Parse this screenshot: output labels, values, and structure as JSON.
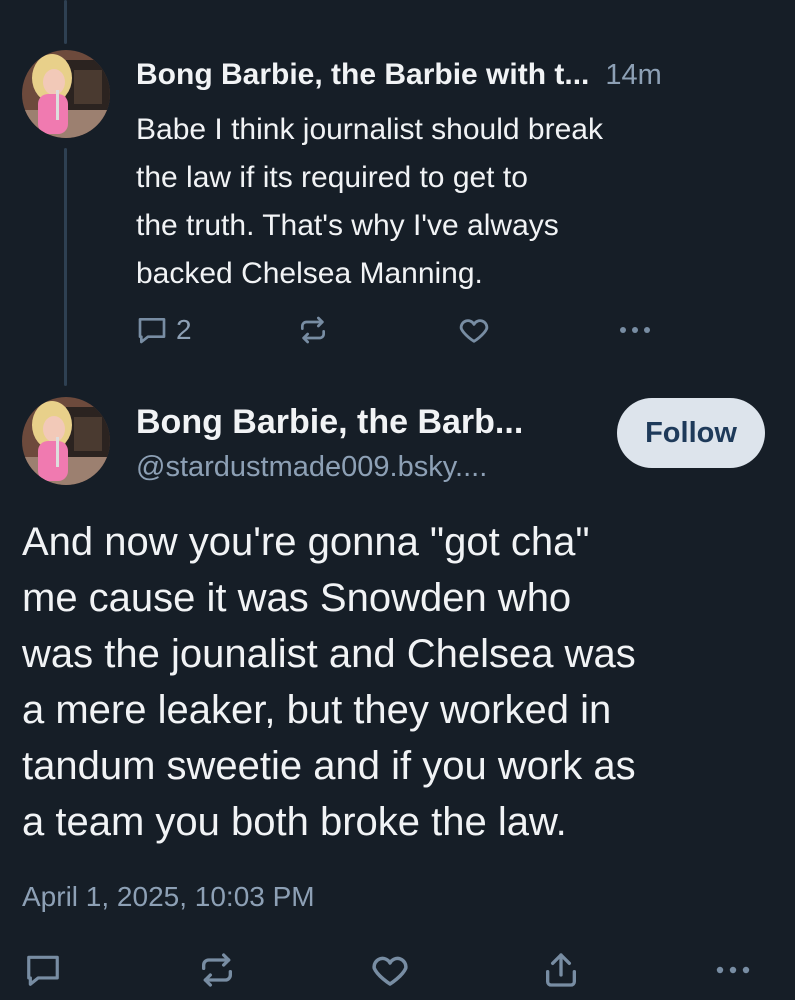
{
  "parent_post": {
    "author_name": "Bong Barbie, the Barbie with t...",
    "time_ago": "14m",
    "text": "Babe I think journalist should break\nthe law if its required to get to\nthe truth. That's why I've always\nbacked Chelsea Manning.",
    "reply_count": "2"
  },
  "main_post": {
    "author_name": "Bong Barbie, the Barb...",
    "handle": "@stardustmade009.bsky....",
    "follow_label": "Follow",
    "text": "And now you're gonna \"got cha\"\nme cause it was Snowden who\nwas the jounalist and Chelsea was\na mere leaker, but they worked in\ntandum sweetie and if you work as\na team you both broke the law.",
    "timestamp": "April 1, 2025, 10:03 PM"
  },
  "icons": {
    "reply": "reply-icon",
    "repost": "repost-icon",
    "like": "like-icon",
    "share": "share-icon",
    "more": "more-icon"
  },
  "colors": {
    "background": "#161e27",
    "text_primary": "#f1f3f5",
    "text_secondary": "#8da0b5",
    "icon": "#788da3",
    "thread_line": "#2e4052",
    "follow_button_bg": "#dde4ec",
    "follow_button_text": "#1e3a5a"
  }
}
